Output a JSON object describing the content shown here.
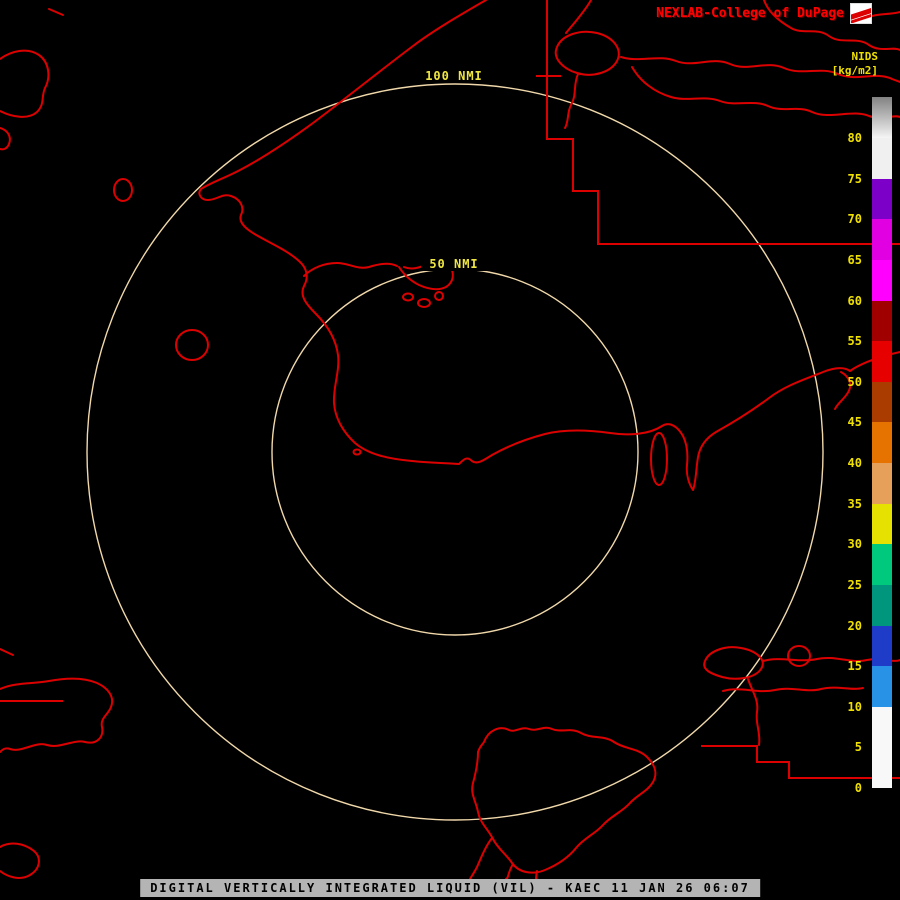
{
  "header": {
    "brand": "NEXLAB-College of DuPage",
    "logo_icon": "cod-flag-icon"
  },
  "legend": {
    "title": "NIDS",
    "units": "[kg/m2]",
    "value_min": 0,
    "value_max": 85,
    "ticks": [
      80,
      75,
      70,
      65,
      60,
      55,
      50,
      45,
      40,
      35,
      30,
      25,
      20,
      15,
      10,
      5,
      0
    ],
    "segments": [
      {
        "from": 0,
        "to": 10,
        "color": "#f8f8f8"
      },
      {
        "from": 10,
        "to": 15,
        "color": "#2892e6"
      },
      {
        "from": 15,
        "to": 20,
        "color": "#1e3cc8"
      },
      {
        "from": 20,
        "to": 25,
        "color": "#00967d"
      },
      {
        "from": 25,
        "to": 30,
        "color": "#00c87d"
      },
      {
        "from": 30,
        "to": 35,
        "color": "#e6e100"
      },
      {
        "from": 35,
        "to": 40,
        "color": "#e6a05a"
      },
      {
        "from": 40,
        "to": 45,
        "color": "#e67300"
      },
      {
        "from": 45,
        "to": 50,
        "color": "#aa3c00"
      },
      {
        "from": 50,
        "to": 55,
        "color": "#e60000"
      },
      {
        "from": 55,
        "to": 60,
        "color": "#a00000"
      },
      {
        "from": 60,
        "to": 65,
        "color": "#ff00ff"
      },
      {
        "from": 65,
        "to": 70,
        "color": "#e100e1"
      },
      {
        "from": 70,
        "to": 75,
        "color": "#7d00c8"
      },
      {
        "from": 75,
        "to": 80,
        "color": "#f0f0f0"
      },
      {
        "from": 80,
        "to": 85,
        "color": "linear-gradient(180deg,#828282,#f5f5f5)"
      }
    ]
  },
  "rings": [
    {
      "label": "100 NMI",
      "radius_nmi": 100
    },
    {
      "label": "50 NMI",
      "radius_nmi": 50
    }
  ],
  "footer": {
    "caption": "DIGITAL VERTICALLY INTEGRATED LIQUID (VIL) - KAEC 11 JAN 26 06:07"
  },
  "colors": {
    "background": "#000000",
    "map_outline": "#dc0000",
    "range_ring": "#f0d8aa",
    "ring_label": "#efe642",
    "tick_label": "#f0e000",
    "legend_label": "#f0e000",
    "header_text": "#ff0000",
    "footer_bg": "#b4b4b4",
    "footer_text": "#000000"
  }
}
